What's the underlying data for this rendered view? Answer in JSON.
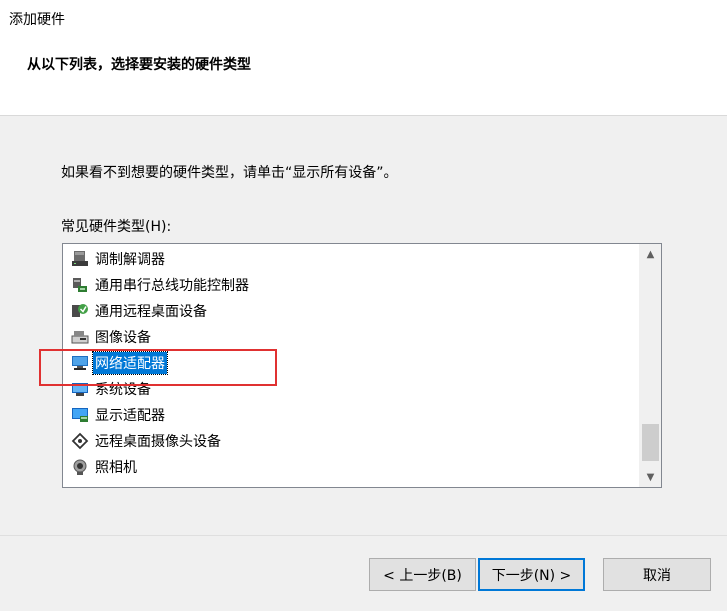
{
  "window": {
    "title": "添加硬件"
  },
  "header": {
    "instruction": "从以下列表，选择要安装的硬件类型"
  },
  "content": {
    "description": "如果看不到想要的硬件类型，请单击“显示所有设备”。",
    "list_label": "常见硬件类型(H):",
    "items": [
      {
        "label": "调制解调器",
        "icon": "modem-icon"
      },
      {
        "label": "通用串行总线功能控制器",
        "icon": "usb-controller-icon"
      },
      {
        "label": "通用远程桌面设备",
        "icon": "remote-desktop-device-icon"
      },
      {
        "label": "图像设备",
        "icon": "imaging-device-icon"
      },
      {
        "label": "网络适配器",
        "icon": "network-adapter-icon",
        "selected": true
      },
      {
        "label": "系统设备",
        "icon": "system-device-icon"
      },
      {
        "label": "显示适配器",
        "icon": "display-adapter-icon"
      },
      {
        "label": "远程桌面摄像头设备",
        "icon": "remote-camera-icon"
      },
      {
        "label": "照相机",
        "icon": "camera-icon"
      }
    ]
  },
  "buttons": {
    "back": "< 上一步(B)",
    "next": "下一步(N) >",
    "cancel": "取消"
  },
  "colors": {
    "selection": "#0078d7",
    "annotation_box": "#e03131"
  }
}
